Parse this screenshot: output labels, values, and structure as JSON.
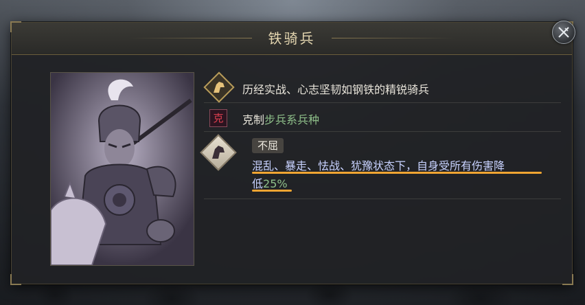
{
  "window": {
    "title": "铁骑兵"
  },
  "unit": {
    "name": "铁骑兵",
    "description": "历经实战、心志坚韧如钢铁的精锐骑兵",
    "counter": {
      "icon_char": "克",
      "prefix": "克制",
      "target": "步兵系兵种"
    },
    "skill": {
      "name": "不屈",
      "desc_line1": "混乱、暴走、怯战、犹豫状态下，自身受所有伤害降",
      "desc_line2_prefix": "低",
      "desc_value": "25%"
    }
  },
  "icons": {
    "close": "close-swords-icon",
    "description": "horse-head-icon",
    "counter": "counter-icon",
    "skill": "dark-horse-icon"
  },
  "colors": {
    "title": "#e4d6b0",
    "highlight_green": "#8fc08a",
    "counter_red": "#e04050",
    "underline_orange": "#f0a532"
  }
}
